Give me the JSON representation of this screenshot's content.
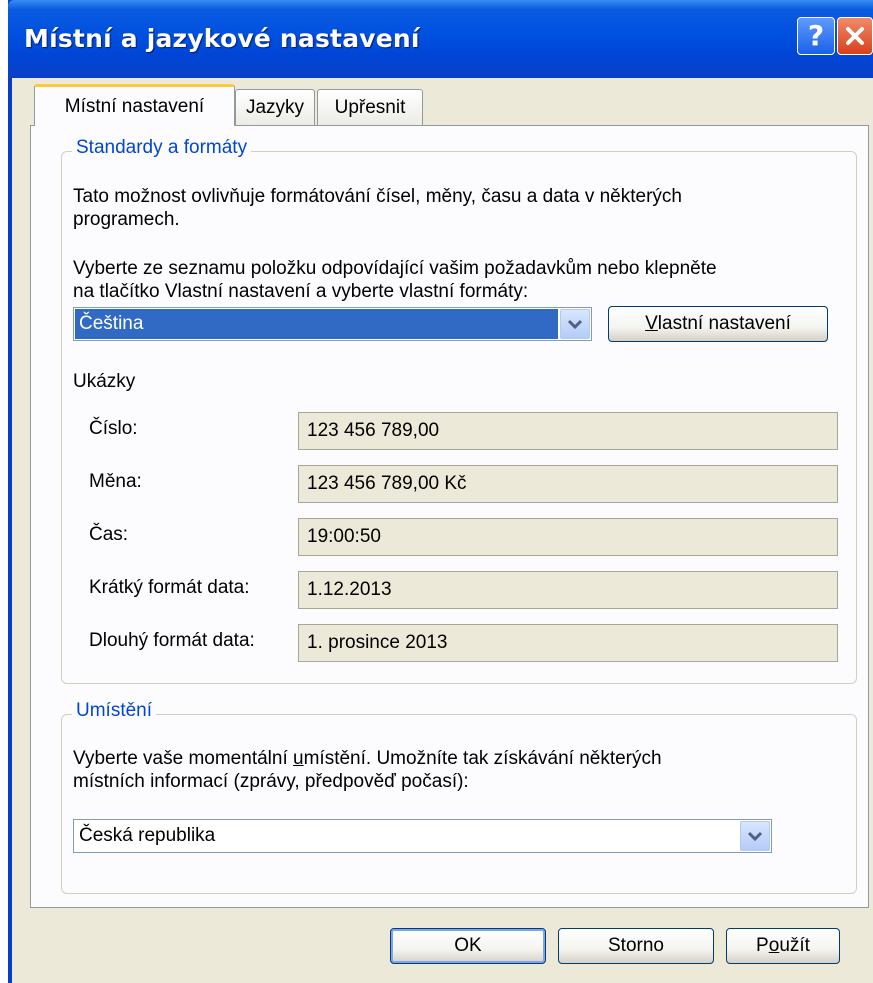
{
  "window": {
    "title": "Místní a jazykové nastavení",
    "help_label": "?"
  },
  "tabs": [
    {
      "label": "Místní nastavení"
    },
    {
      "label": "Jazyky"
    },
    {
      "label": "Upřesnit"
    }
  ],
  "standards": {
    "legend": "Standardy a formáty",
    "desc1_line1": "Tato možnost ovlivňuje formátování čísel, měny, času a data v některých",
    "desc1_line2": "programech.",
    "desc2_line1": "Vyberte ze seznamu položku odpovídající vašim požadavkům nebo klepněte",
    "desc2_line2": "na tlačítko Vlastní nastavení a vyberte vlastní formáty:",
    "format_value": "Čeština",
    "custom_button_accel": "V",
    "custom_button_rest": "lastní nastavení",
    "samples_title": "Ukázky",
    "samples": [
      {
        "label": "Číslo:",
        "value": "123 456 789,00"
      },
      {
        "label": "Měna:",
        "value": "123 456 789,00 Kč"
      },
      {
        "label": "Čas:",
        "value": "19:00:50"
      },
      {
        "label": "Krátký formát data:",
        "value": "1.12.2013"
      },
      {
        "label": "Dlouhý formát data:",
        "value": "1. prosince 2013"
      }
    ]
  },
  "location": {
    "legend": "Umístění",
    "desc_line1_pre": "Vyberte vaše momentální ",
    "desc_line1_accel": "u",
    "desc_line1_post": "místění. Umožníte tak získávání některých",
    "desc_line2": "místních informací (zprávy, předpověď počasí):",
    "value": "Česká republika"
  },
  "buttons": {
    "ok": "OK",
    "cancel": "Storno",
    "apply_pre": "P",
    "apply_accel": "o",
    "apply_post": "užít"
  },
  "colors": {
    "titlebar": "#0050e0",
    "legend_text": "#0046d5",
    "selection": "#316ac5",
    "close_button": "#d8401a",
    "tab_highlight": "#ffc83c"
  }
}
